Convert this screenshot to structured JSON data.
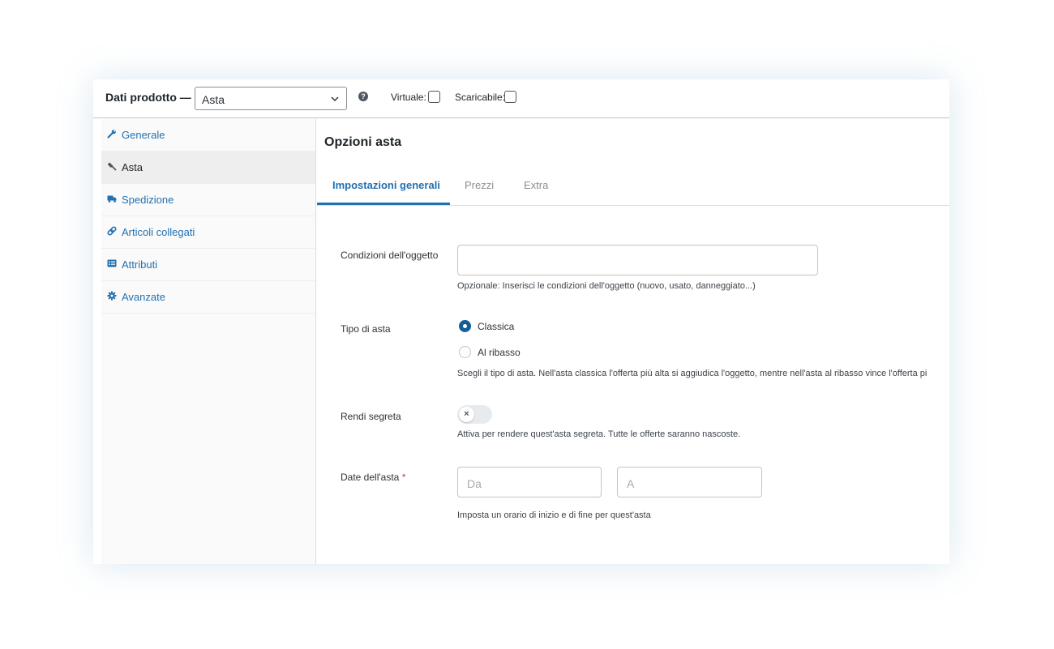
{
  "header": {
    "title": "Dati prodotto —",
    "product_type": "Asta",
    "virtual_label": "Virtuale:",
    "downloadable_label": "Scaricabile:",
    "help": "?"
  },
  "sidebar": {
    "items": [
      {
        "label": "Generale",
        "icon": "wrench-icon"
      },
      {
        "label": "Asta",
        "icon": "gavel-icon",
        "active": true
      },
      {
        "label": "Spedizione",
        "icon": "truck-icon"
      },
      {
        "label": "Articoli collegati",
        "icon": "link-icon"
      },
      {
        "label": "Attributi",
        "icon": "list-icon"
      },
      {
        "label": "Avanzate",
        "icon": "gear-icon"
      }
    ]
  },
  "main": {
    "title": "Opzioni asta",
    "tabs": [
      {
        "label": "Impostazioni generali",
        "active": true
      },
      {
        "label": "Prezzi"
      },
      {
        "label": "Extra"
      }
    ],
    "conditions": {
      "label": "Condizioni dell'oggetto",
      "value": "",
      "help": "Opzionale: Inserisci le condizioni dell'oggetto (nuovo, usato, danneggiato...)"
    },
    "auction_type": {
      "label": "Tipo di asta",
      "options": [
        "Classica",
        "Al ribasso"
      ],
      "selected": "Classica",
      "help": "Scegli il tipo di asta. Nell'asta classica l'offerta più alta si aggiudica l'oggetto, mentre nell'asta al ribasso vince l'offerta pi"
    },
    "secret": {
      "label": "Rendi segreta",
      "enabled": false,
      "knob": "×",
      "help": "Attiva per rendere quest'asta segreta. Tutte le offerte saranno nascoste."
    },
    "dates": {
      "label": "Date dell'asta",
      "required_mark": "*",
      "from_placeholder": "Da",
      "to_placeholder": "A",
      "help": "Imposta un orario di inizio e di fine per quest'asta"
    }
  },
  "colors": {
    "accent": "#2271b1",
    "required": "#d63638"
  }
}
